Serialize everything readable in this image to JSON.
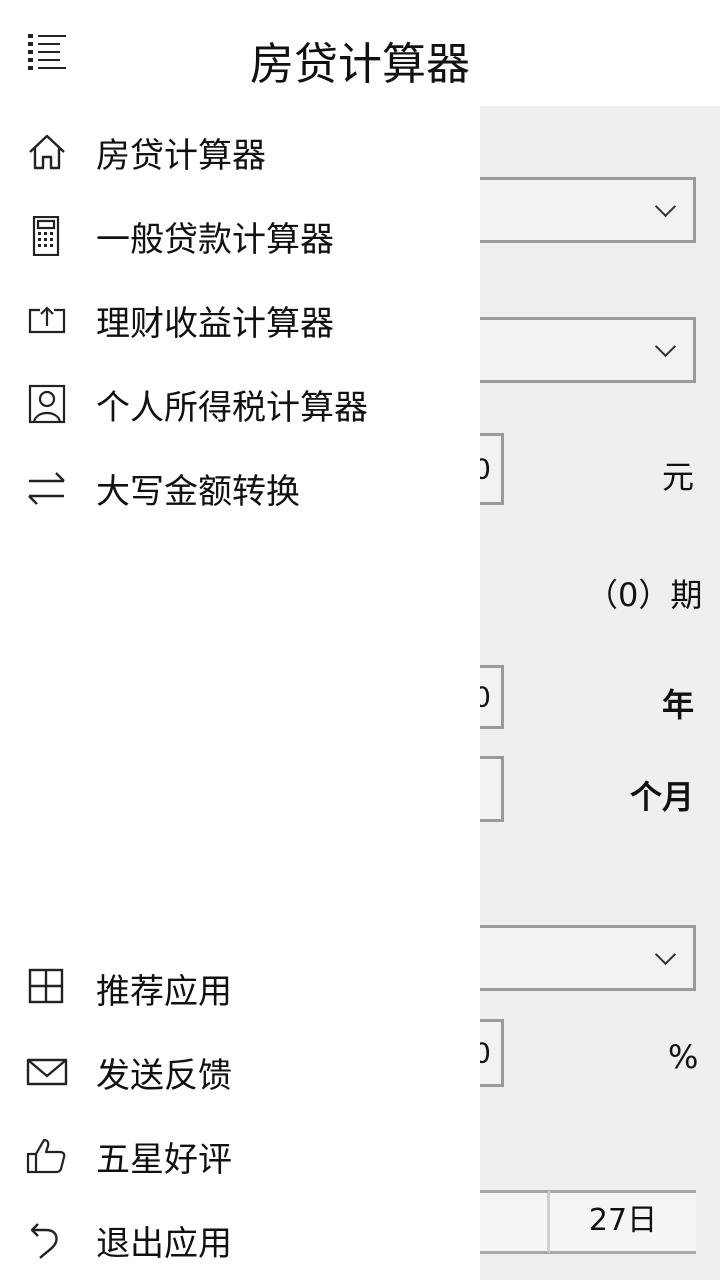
{
  "header": {
    "title": "房贷计算器",
    "menu_icon": "hamburger-list-icon"
  },
  "nav": {
    "items": [
      {
        "label": "房贷计算器",
        "icon": "home-icon"
      },
      {
        "label": "一般贷款计算器",
        "icon": "calculator-icon"
      },
      {
        "label": "理财收益计算器",
        "icon": "upload-box-icon"
      },
      {
        "label": "个人所得税计算器",
        "icon": "contact-card-icon"
      },
      {
        "label": "大写金额转换",
        "icon": "swap-arrows-icon"
      }
    ],
    "bottom_items": [
      {
        "label": "推荐应用",
        "icon": "grid-icon"
      },
      {
        "label": "发送反馈",
        "icon": "mail-icon"
      },
      {
        "label": "五星好评",
        "icon": "thumbs-up-icon"
      },
      {
        "label": "退出应用",
        "icon": "undo-icon"
      }
    ]
  },
  "background_form": {
    "amount_peek": "0",
    "amount_unit": "元",
    "periods": "（0）期",
    "years_peek": "0",
    "years_unit": "年",
    "months_unit": "个月",
    "rate_peek": "0",
    "rate_unit": "%",
    "date_day": "27日"
  },
  "colors": {
    "drawer_bg": "#ffffff",
    "page_bg": "#efefef",
    "border": "#9a9a9a"
  }
}
